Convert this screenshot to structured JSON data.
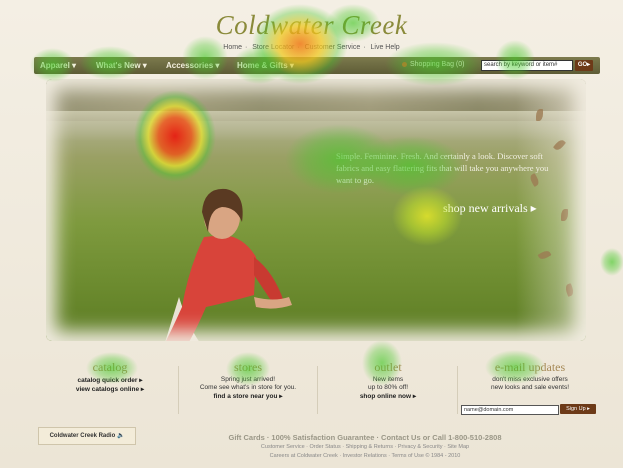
{
  "brand": {
    "name": "Coldwater Creek"
  },
  "utility_nav": {
    "items": [
      "Home",
      "Store Locator",
      "Customer Service",
      "Live Help"
    ]
  },
  "nav": {
    "items": [
      "Apparel",
      "What's New",
      "Accessories",
      "Home & Gifts"
    ],
    "shopping_bag": "Shopping Bag (0)",
    "search_placeholder": "search by keyword or item#",
    "go_label": "GO"
  },
  "hero": {
    "promo_text": "Simple. Feminine. Fresh. And certainly a look. Discover soft fabrics and easy flattering fits that will take you anywhere you want to go.",
    "cta": "shop new arrivals"
  },
  "sections": [
    {
      "heading": "catalog",
      "text": [],
      "links": [
        "catalog quick order",
        "view catalogs online"
      ]
    },
    {
      "heading": "stores",
      "text": [
        "Spring just arrived!",
        "Come see what's in store for you."
      ],
      "links": [
        "find a store near you"
      ]
    },
    {
      "heading": "outlet",
      "text": [
        "New items",
        "up to 80% off!"
      ],
      "links": [
        "shop online now"
      ]
    },
    {
      "heading": "e-mail updates",
      "text": [
        "don't miss exclusive offers",
        "new looks and sale events!"
      ],
      "links": []
    }
  ],
  "email": {
    "value": "name@domain.com",
    "signup_label": "Sign Up"
  },
  "radio": {
    "label": "Coldwater Creek Radio"
  },
  "footer": {
    "main": "Gift Cards  ·  100% Satisfaction Guarantee  ·  Contact Us or Call 1-800-510-2808",
    "links": "Customer Service  ·  Order Status  ·  Shipping & Returns  ·  Privacy & Security  ·  Site Map",
    "legal": "Careers at Coldwater Creek  ·  Investor Relations  ·  Terms of Use © 1984 - 2010"
  },
  "colors": {
    "nav": "#6b6940",
    "accent": "#6d3a18",
    "heading": "#a78a58",
    "brand": "#8a8a3a"
  }
}
